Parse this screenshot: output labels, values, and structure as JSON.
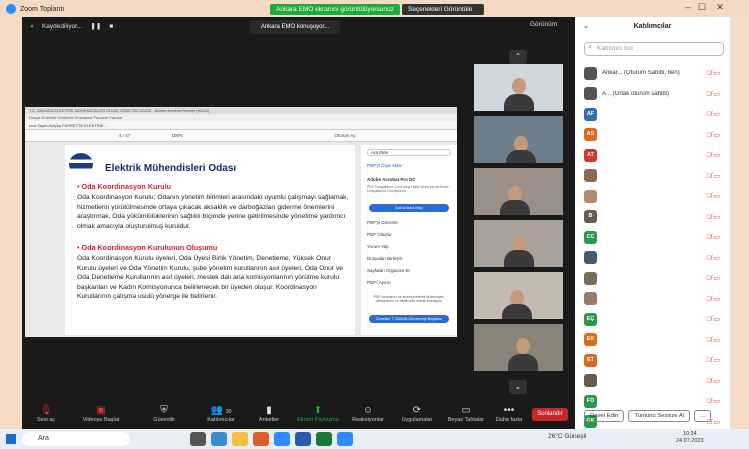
{
  "window": {
    "title": "Zoom Toplantı"
  },
  "banner": {
    "share_text": "Ankara EMO ekranını görüntülüyorsunuz",
    "view_label": "Seçenekleri Görüntüle"
  },
  "topbar": {
    "recording": "Kaydediliyor...",
    "speaking": "Ankara EMO konuşuyor...",
    "view": "Görünüm"
  },
  "shared_doc": {
    "app_title": "T.C. ANKARA ELEKTRİK MÜHENDİSLERİ ODASI YÖNETİM ODASI - Adobe Acrobat Reader (64-bit)",
    "menu": "Dosya Düzenle Görünüm İmzalama Pencere Yardım",
    "tabs": "Ana Sayfa  Araçlar  FAHRETTE ELEKTRİK...",
    "page": "4 / 47",
    "zoom": "100%",
    "account": "Oturum Aç",
    "title": "Elektrik Mühendisleri Odası",
    "heading1": "• Oda Koordinasyon Kurulu",
    "para1": "Oda Koordinasyon Kurulu; Odanın yönetim birimleri arasındaki uyumlu çalışmayı sağlamak, hizmetlerin yürütülmesinde ortaya çıkacak aksaklık ve darboğazları giderme önemlerini araştırmak, Oda yükümlülüklerinin sağlıklı biçimde yerine getirilmesinde yönetime yardımcı olmak amacıyla oluşturulmuş kuruldur.",
    "heading2": "• Oda Koordinasyon Kurulunun Oluşumu",
    "para2": "Oda Koordinasyon Kurulu üyeleri, Oda Üyesi Birlik Yönetim, Denetleme, Yüksek Onur Kurulu üyeleri ve Oda Yönetim Kurulu, şube yönetim kurullarının asıl üyeleri, Oda Onur ve Oda Denetleme Kurullarının asıl üyeleri, meslek dalı ana komisyonlarının yürütme kurulu başkanları ve Kadın Komisyonunca belirlenecek bir üyeden oluşur. Koordinasyon Kurullarının çalışma usulü yönerge ile belirlenir."
  },
  "side_panel": {
    "search": "Ara Ekle",
    "item1": "PDF'yi Dışa Aktar",
    "item2": "Adobe Acrobat Pro DC",
    "item3": "PDF Dosyalarını Çevirmeyi Hizla Word ya da Excel Dosyalarına Dönüştürün.",
    "btn1": "Daha fazla bilgi",
    "tool1": "PDF'yi Düzenle",
    "tool2": "PDF Oluştur",
    "tool3": "Yorum Yap",
    "tool4": "Dosyaları Birleştir",
    "tool5": "Sayfaları Organize Et",
    "tool6": "PDF'i Ayırın",
    "note": "PDF formlarını ve sözleşmelerini düzenleyin, dönüştürün ve elektronik olarak imzalayın",
    "btn2": "Ücretsiz 7 Günlük Denemeyi Başlatın"
  },
  "toolbar": {
    "items": [
      "Sesi aç",
      "Videoyu Başlat",
      "Güvenlik",
      "Katılımcılar",
      "Anketler",
      "Ekranı Paylaşma",
      "Reaksiyonlar",
      "Uygulamalar",
      "Beyaz Tahtalar",
      "Daha fazla"
    ],
    "participants_count": "30",
    "end": "Sonlandır"
  },
  "participants": {
    "title": "Katılımcılar",
    "search_placeholder": "Katılımcı bul",
    "list": [
      {
        "initials": "",
        "name": "Ankar... (Oturum Sahibi, ben)",
        "color": "#555555"
      },
      {
        "initials": "",
        "name": "A... (Ortak oturum sahibi)",
        "color": "#555555"
      },
      {
        "initials": "AF",
        "name": "",
        "color": "#2f6fb0"
      },
      {
        "initials": "AS",
        "name": "",
        "color": "#e06a1b"
      },
      {
        "initials": "AT",
        "name": "",
        "color": "#d9342b"
      },
      {
        "initials": "",
        "name": "",
        "color": "#8a6a55"
      },
      {
        "initials": "",
        "name": "",
        "color": "#b58a70"
      },
      {
        "initials": "B",
        "name": "",
        "color": "#6b5a50"
      },
      {
        "initials": "CC",
        "name": "",
        "color": "#2a9a4a"
      },
      {
        "initials": "",
        "name": "",
        "color": "#4a5a6a"
      },
      {
        "initials": "",
        "name": "",
        "color": "#7a6a5a"
      },
      {
        "initials": "",
        "name": "",
        "color": "#9a7a6a"
      },
      {
        "initials": "EÇ",
        "name": "",
        "color": "#2a9a4a"
      },
      {
        "initials": "EK",
        "name": "",
        "color": "#e06a1b"
      },
      {
        "initials": "ET",
        "name": "",
        "color": "#e06a1b"
      },
      {
        "initials": "",
        "name": "",
        "color": "#6a5a50"
      },
      {
        "initials": "FÖ",
        "name": "",
        "color": "#2a9a4a"
      },
      {
        "initials": "GK",
        "name": "",
        "color": "#2a9a4a"
      }
    ],
    "invite": "Davet Edin",
    "mute_all": "Tümünü Sessize Al",
    "more": "..."
  },
  "taskbar": {
    "search": "Ara",
    "weather": "26°C Güneşli",
    "time": "10:34",
    "date": "24.07.2023"
  }
}
